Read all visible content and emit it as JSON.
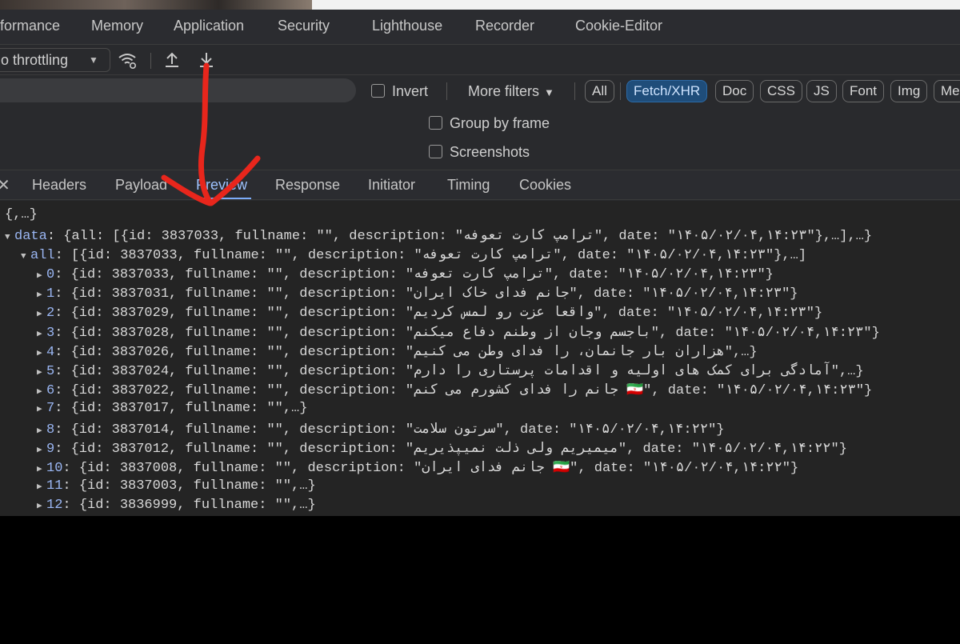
{
  "panel_tabs": [
    "rformance",
    "Memory",
    "Application",
    "Security",
    "Lighthouse",
    "Recorder",
    "Cookie-Editor"
  ],
  "toolbar": {
    "throttling_value": "o throttling",
    "icons": [
      "wifi-settings-icon",
      "upload-icon",
      "download-icon"
    ]
  },
  "filters": {
    "invert_label": "Invert",
    "more_filters_label": "More filters",
    "chips": [
      "All",
      "Fetch/XHR",
      "Doc",
      "CSS",
      "JS",
      "Font",
      "Img",
      "Me"
    ],
    "active_chip": "Fetch/XHR"
  },
  "options": {
    "group_by_frame": "Group by frame",
    "screenshots": "Screenshots"
  },
  "detail_tabs": [
    "Headers",
    "Payload",
    "Preview",
    "Response",
    "Initiator",
    "Timing",
    "Cookies"
  ],
  "active_detail_tab": "Preview",
  "preview": {
    "root": "{,…}",
    "data_key": "data",
    "data_summary": "{all: [{id: 3837033, fullname: \"\", description: \"ترامپ کارت تعوفه\", date: \"۱۴۰۵/۰۲/۰۴,۱۴:۲۳\"},…],…}",
    "all_key": "all",
    "all_summary": "[{id: 3837033, fullname: \"\", description: \"ترامپ کارت تعوفه\", date: \"۱۴۰۵/۰۲/۰۴,۱۴:۲۳\"},…]",
    "items": [
      {
        "index": "0",
        "summary": "{id: 3837033, fullname: \"\", description: \"ترامپ کارت تعوفه\", date: \"۱۴۰۵/۰۲/۰۴,۱۴:۲۳\"}"
      },
      {
        "index": "1",
        "summary": "{id: 3837031, fullname: \"\", description: \"جانم فدای خاک ایران\", date: \"۱۴۰۵/۰۲/۰۴,۱۴:۲۳\"}"
      },
      {
        "index": "2",
        "summary": "{id: 3837029, fullname: \"\", description: \"واقعا عزت رو لمس کردیم\", date: \"۱۴۰۵/۰۲/۰۴,۱۴:۲۳\"}"
      },
      {
        "index": "3",
        "summary": "{id: 3837028, fullname: \"\", description: \"باجسم وجان از وطنم دفاع میکنم\", date: \"۱۴۰۵/۰۲/۰۴,۱۴:۲۳\"}"
      },
      {
        "index": "4",
        "summary": "{id: 3837026, fullname: \"\", description: \"هزاران بار جانمان، را فدای وطن می کنیم\",…}"
      },
      {
        "index": "5",
        "summary": "{id: 3837024, fullname: \"\", description: \"آمادگی برای کمک های اولیه و اقدامات پرستاری را دارم\",…}"
      },
      {
        "index": "6",
        "summary": "{id: 3837022, fullname: \"\", description: \"جانم را فدای کشورم می کنم 🇮🇷\", date: \"۱۴۰۵/۰۲/۰۴,۱۴:۲۳\"}"
      },
      {
        "index": "7",
        "summary": "{id: 3837017, fullname: \"\",…}"
      },
      {
        "index": "8",
        "summary": "{id: 3837014, fullname: \"\", description: \"سرتون سلامت\", date: \"۱۴۰۵/۰۲/۰۴,۱۴:۲۲\"}"
      },
      {
        "index": "9",
        "summary": "{id: 3837012, fullname: \"\", description: \"میمیریم ولی ذلت نمیپذیریم\", date: \"۱۴۰۵/۰۲/۰۴,۱۴:۲۲\"}"
      },
      {
        "index": "10",
        "summary": "{id: 3837008, fullname: \"\", description: \"جانم فدای ایران 🇮🇷\", date: \"۱۴۰۵/۰۲/۰۴,۱۴:۲۲\"}"
      },
      {
        "index": "11",
        "summary": "{id: 3837003, fullname: \"\",…}"
      },
      {
        "index": "12",
        "summary": "{id: 3836999, fullname: \"\",…}"
      }
    ]
  },
  "annotation": {
    "color": "#e8261c"
  }
}
